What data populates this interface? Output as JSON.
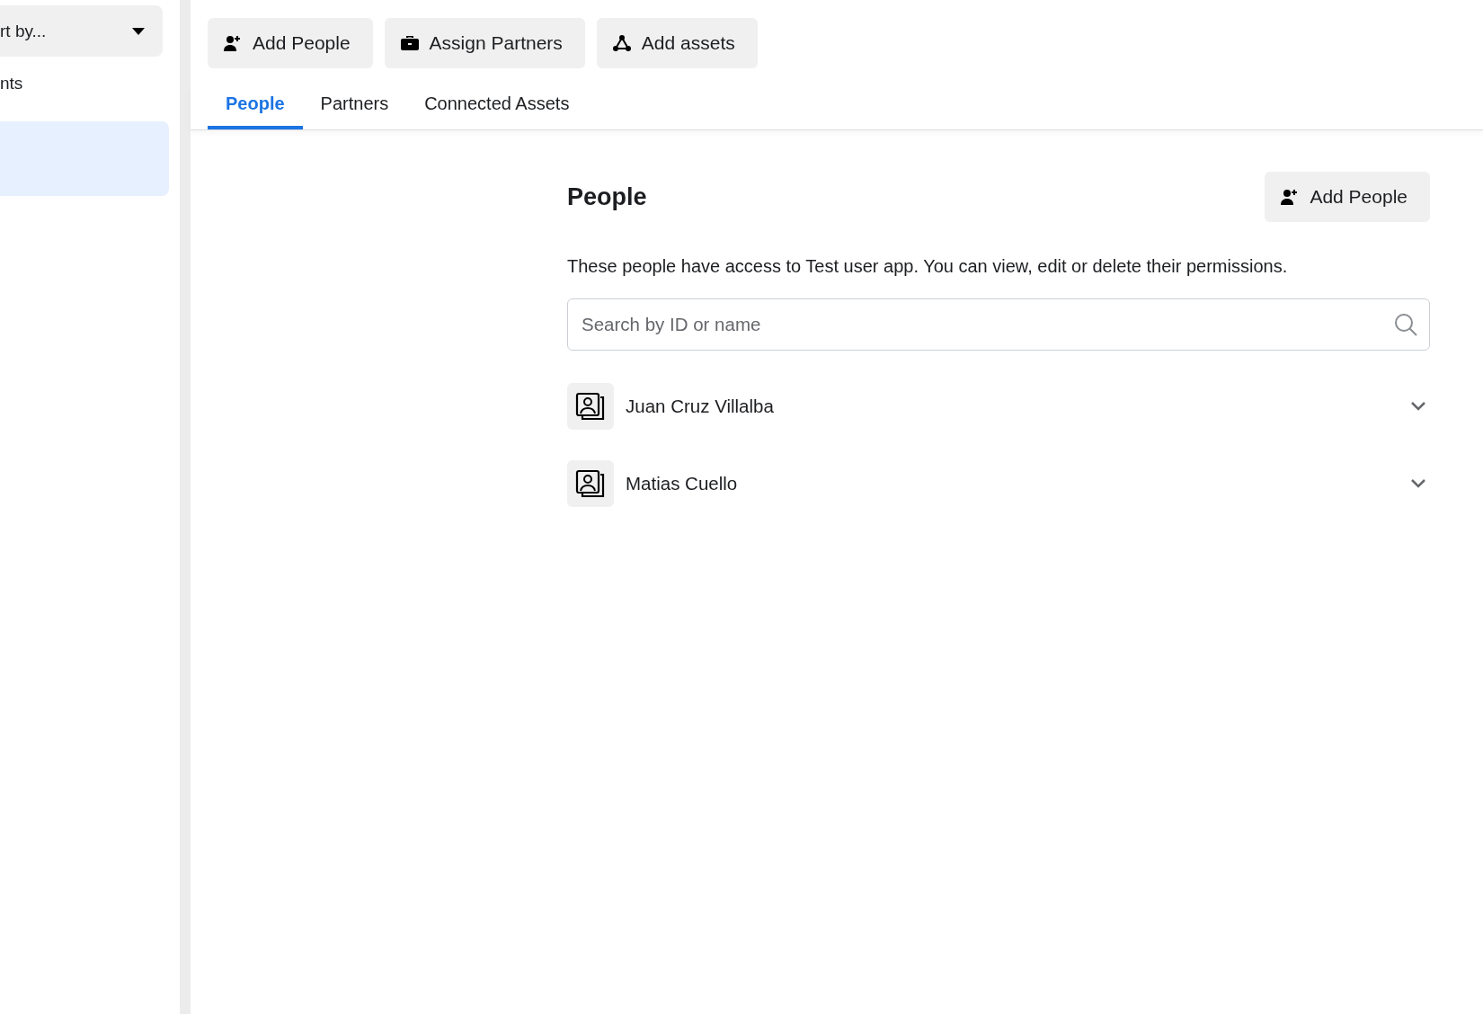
{
  "sidebar": {
    "sort": {
      "label": "rt by..."
    },
    "items": [
      {
        "label": "nts",
        "selected": false
      },
      {
        "selected": true
      }
    ]
  },
  "toolbar": [
    {
      "label": "Add People"
    },
    {
      "label": "Assign Partners"
    },
    {
      "label": "Add assets"
    }
  ],
  "tabs": [
    {
      "label": "People",
      "selected": true
    },
    {
      "label": "Partners",
      "selected": false
    },
    {
      "label": "Connected Assets",
      "selected": false
    }
  ],
  "panel": {
    "title": "People",
    "add_button": "Add People",
    "description": "These people have access to Test user app. You can view, edit or delete their permissions.",
    "search": {
      "placeholder": "Search by ID or name"
    },
    "people": [
      {
        "name": "Juan Cruz Villalba",
        "expanded": false
      },
      {
        "name": "Matias Cuello",
        "expanded": false
      }
    ]
  }
}
